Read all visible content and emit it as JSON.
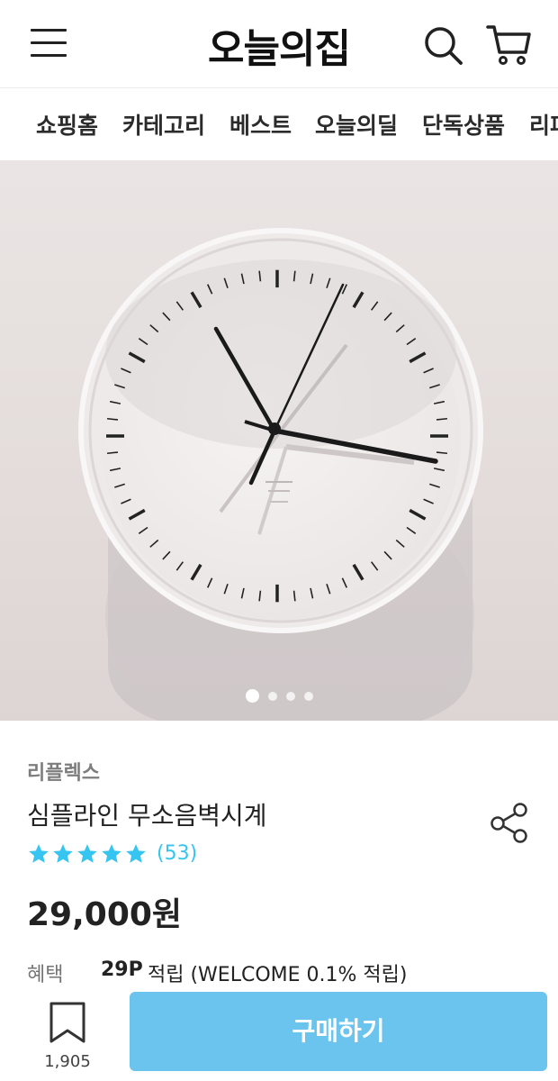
{
  "header": {
    "logo": "오늘의집",
    "menu_icon": "hamburger-menu-icon",
    "search_icon": "search-icon",
    "cart_icon": "cart-icon"
  },
  "nav": {
    "items": [
      "쇼핑홈",
      "카테고리",
      "베스트",
      "오늘의딜",
      "단독상품",
      "리퍼"
    ]
  },
  "hero": {
    "slide_count": 4,
    "active_slide": 1
  },
  "product": {
    "brand": "리플렉스",
    "name": "심플라인 무소음벽시계",
    "rating_stars": 5,
    "review_count": "(53)",
    "price": "29,000원",
    "benefit_label": "혜택",
    "benefit_point": "29P",
    "benefit_text": "적립 (WELCOME 0.1% 적립)"
  },
  "bottom": {
    "bookmark_count": "1,905",
    "buy_label": "구매하기"
  },
  "colors": {
    "accent": "#35c5f0",
    "buy_button": "#6ac4ee",
    "hero_bg": "#e6e0df"
  }
}
